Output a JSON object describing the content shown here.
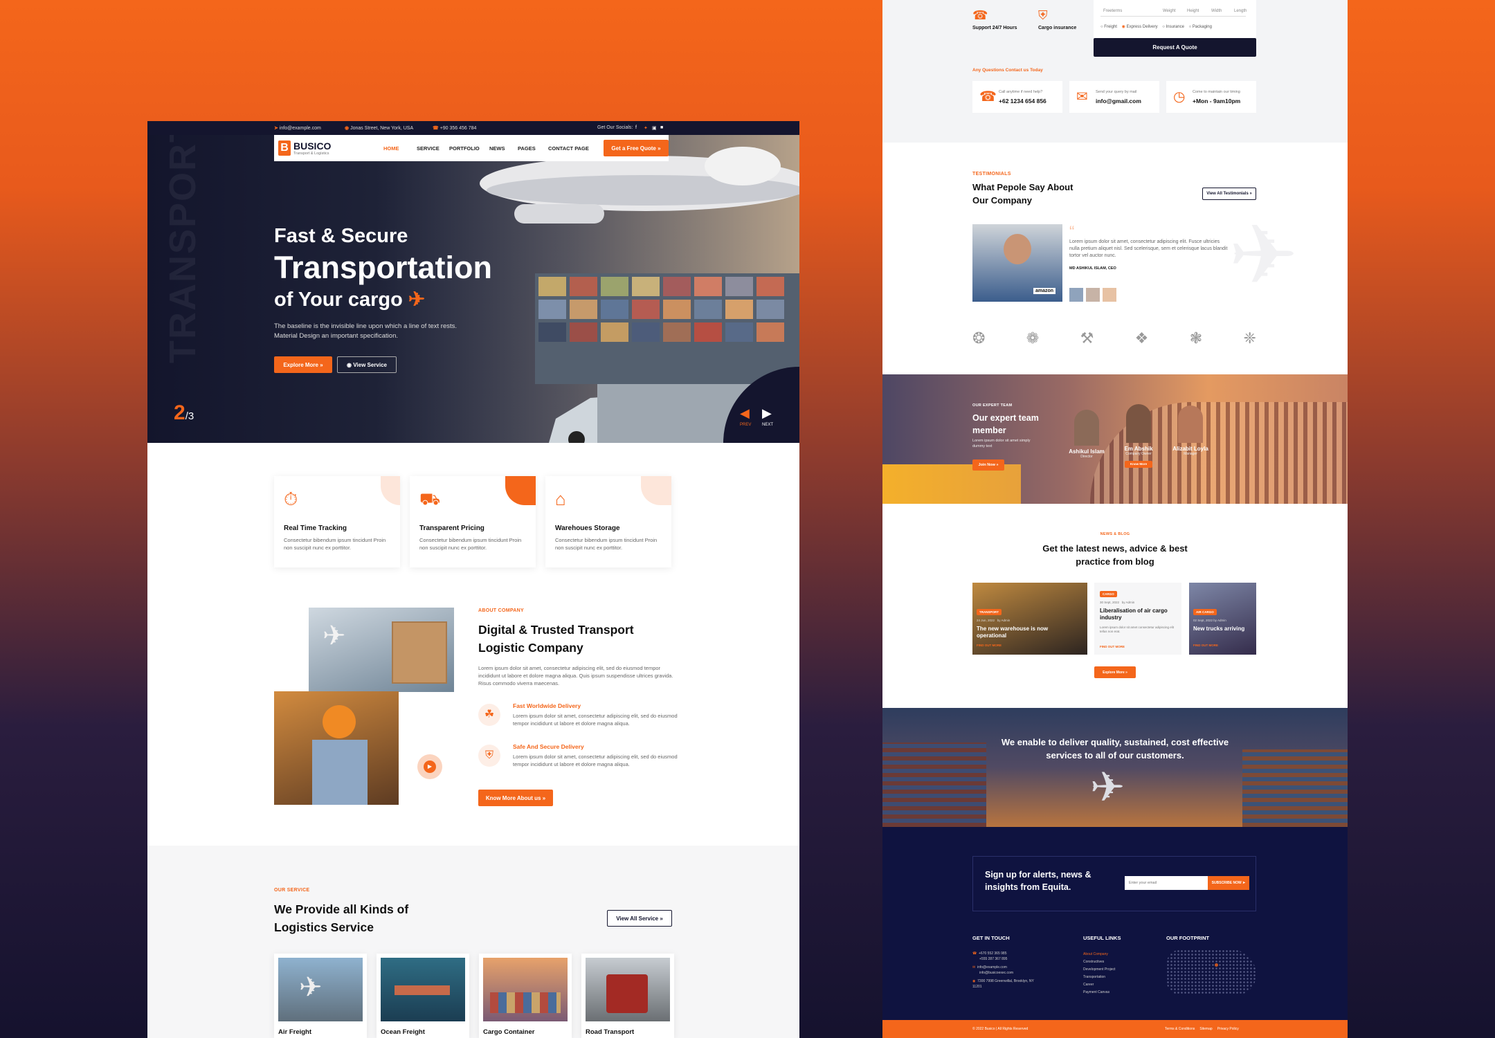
{
  "left": {
    "topbar": {
      "email": "info@example.com",
      "address": "Jonas Street, New York, USA",
      "phone": "+90 356 456 784",
      "social_label": "Get Our Socials:"
    },
    "nav": {
      "brand": "BUSICO",
      "brand_sub": "Transport & Logistics",
      "links": [
        "HOME",
        "SERVICE",
        "PORTFOLIO",
        "NEWS",
        "PAGES",
        "CONTACT PAGE"
      ],
      "cta": "Get a Free Quote"
    },
    "hero": {
      "watermark": "TRANSPORT",
      "line1": "Fast & Secure",
      "line2": "Transportation",
      "line3": "of Your cargo",
      "desc": "The baseline is the invisible line upon which a line of text rests. Material Design an important specification.",
      "btn_primary": "Explore More",
      "btn_secondary": "View Service",
      "slide_current": "2",
      "slide_total": "/3",
      "prev": "PREV",
      "next": "NEXT"
    },
    "features": [
      {
        "title": "Real Time Tracking",
        "text": "Consectetur bibendum ipsum tincidunt Proin non suscipit nunc ex porttitor."
      },
      {
        "title": "Transparent Pricing",
        "text": "Consectetur bibendum ipsum tincidunt Proin non suscipit nunc ex porttitor."
      },
      {
        "title": "Warehoues Storage",
        "text": "Consectetur bibendum ipsum tincidunt Proin non suscipit nunc ex porttitor."
      }
    ],
    "about": {
      "label": "ABOUT COMPANY",
      "title": "Digital & Trusted Transport Logistic Company",
      "text": "Lorem ipsum dolor sit amet, consectetur adipiscing elit, sed do eiusmod tempor incididunt ut labore et dolore magna aliqua. Quis ipsum suspendisse ultrices gravida. Risus commodo viverra maecenas.",
      "items": [
        {
          "title": "Fast Worldwide Delivery",
          "text": "Lorem ipsum dolor sit amet, consectetur adipiscing elit, sed do eiusmod tempor incididunt ut labore et dolore magna aliqua."
        },
        {
          "title": "Safe And Secure Delivery",
          "text": "Lorem ipsum dolor sit amet, consectetur adipiscing elit, sed do eiusmod tempor incididunt ut labore et dolore magna aliqua."
        }
      ],
      "button": "Know More About us"
    },
    "services": {
      "label": "OUR SERVICE",
      "title": "We Provide all Kinds of Logistics Service",
      "button": "View All Service",
      "items": [
        "Air Freight",
        "Ocean Freight",
        "Cargo Container",
        "Road Transport"
      ]
    }
  },
  "right": {
    "top": {
      "support": "Support 24/7 Hours",
      "insurance": "Cargo insurance",
      "form_fields": [
        "Freeterms",
        "Weight",
        "Height",
        "Width",
        "Length"
      ],
      "radios": [
        "Freight",
        "Express Delivery",
        "Insurance",
        "Packaging"
      ],
      "quote_btn": "Request A Quote",
      "questions": "Any Questions Contact us Today",
      "contacts": [
        {
          "label": "Call anytime if need help?",
          "value": "+62 1234 654 856"
        },
        {
          "label": "Send your query by mail",
          "value": "info@gmail.com"
        },
        {
          "label": "Come to maintain our timing",
          "value": "+Mon - 9am10pm"
        }
      ]
    },
    "testimonials": {
      "label": "TESTIMONIALS",
      "title": "What Pepole Say About Our Company",
      "button": "View All Testimonials",
      "quote": "Lorem ipsum dolor sit amet, consectetur adipiscing elit. Fusce ultricies nulla pretium aliquet nisl. Sed scelerisque, sem et celerisque lacus blandit tortor vel auctor nunc.",
      "author": "MD ASHIKUL ISLAM, CEO",
      "badge": "amazon"
    },
    "team": {
      "label": "OUR EXPERT TEAM",
      "title": "Our expert team member",
      "text": "Lorem ipsum dolor sit amet simply dummy text",
      "button": "Join Now",
      "members": [
        {
          "name": "Ashikul Islam",
          "role": "Director"
        },
        {
          "name": "Em Abshik",
          "role": "Company Owner"
        },
        {
          "name": "Alizabit Loyla",
          "role": "Manager"
        }
      ],
      "member_btn": "Know More"
    },
    "blog": {
      "label": "NEWS & BLOG",
      "title": "Get the latest news, advice & best practice from blog",
      "posts": [
        {
          "tag": "TRANSPORT",
          "date": "24 Jun, 2022",
          "author": "by Admin",
          "title": "The new warehouse is now operational",
          "link": "FIND OUT MORE"
        },
        {
          "tag": "CARGO",
          "date": "30 Sept, 2022",
          "author": "by Admin",
          "title": "Liberalisation of air cargo industry",
          "text": "Lorem ipsum dolor sit amet consectetur adipiscing elit tellus non erat.",
          "link": "FIND OUT MORE"
        },
        {
          "tag": "AIR CARGO",
          "date": "02 Sept, 2022",
          "author": "by Admin",
          "title": "New trucks arriving",
          "link": "FIND OUT MORE"
        }
      ],
      "button": "Explore More"
    },
    "banner": "We enable to deliver quality, sustained, cost effective services to all of our customers.",
    "newsletter": {
      "title": "Sign up for alerts, news & insights from Equita.",
      "placeholder": "Enter your email",
      "button": "SUBSCRIBE NOW"
    },
    "footer": {
      "touch_title": "GET IN TOUCH",
      "touch": [
        "+670 552 365 985",
        "+555 287 367 895",
        "info@example.com",
        "info@busicoexec.com",
        "7300 7998 Greenwillal, Brooklyn, NY 11201"
      ],
      "links_title": "USEFUL LINKS",
      "links": [
        "About Company",
        "Constructives",
        "Development Project",
        "Transportation",
        "Career",
        "Payment Canvas"
      ],
      "footprint_title": "OUR FOOTPRINT",
      "copyright": "© 2022 Busico | All Rights Reserved",
      "bottom_links": [
        "Terms & Conditions",
        "Sitemap",
        "Privacy Policy"
      ]
    }
  },
  "colors": {
    "accent": "#f4661b",
    "navy": "#14152e"
  }
}
